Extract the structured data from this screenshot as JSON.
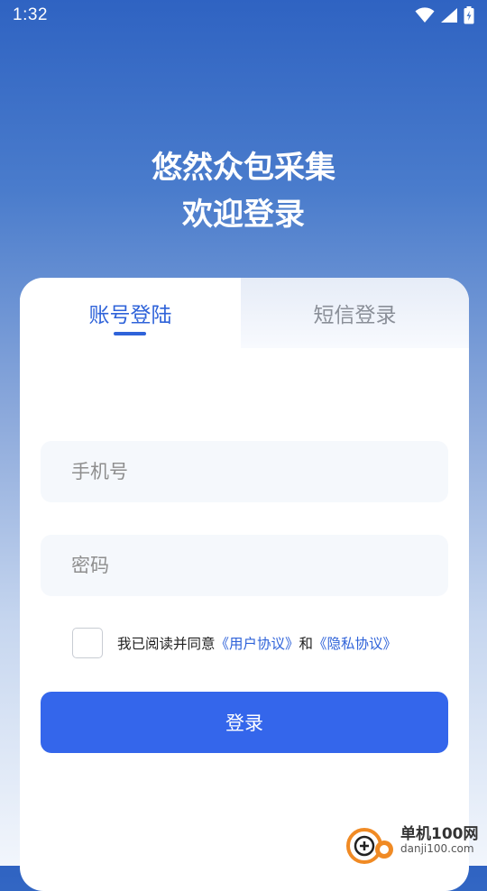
{
  "status_bar": {
    "time": "1:32",
    "icons": [
      "wifi-icon",
      "signal-icon",
      "battery-icon"
    ]
  },
  "header": {
    "title_line1": "悠然众包采集",
    "title_line2": "欢迎登录"
  },
  "tabs": [
    {
      "label": "账号登陆",
      "active": true
    },
    {
      "label": "短信登录",
      "active": false
    }
  ],
  "form": {
    "phone_placeholder": "手机号",
    "password_placeholder": "密码",
    "agreement": {
      "prefix": "我已阅读并同意",
      "user_agreement": "《用户协议》",
      "conjunction": "和",
      "privacy_policy": "《隐私协议》"
    },
    "login_label": "登录"
  },
  "watermark": {
    "name": "单机100网",
    "domain": "danji100.com"
  },
  "colors": {
    "accent": "#3466eb",
    "link": "#2f63d9",
    "header_gradient_top": "#2f63c2"
  }
}
